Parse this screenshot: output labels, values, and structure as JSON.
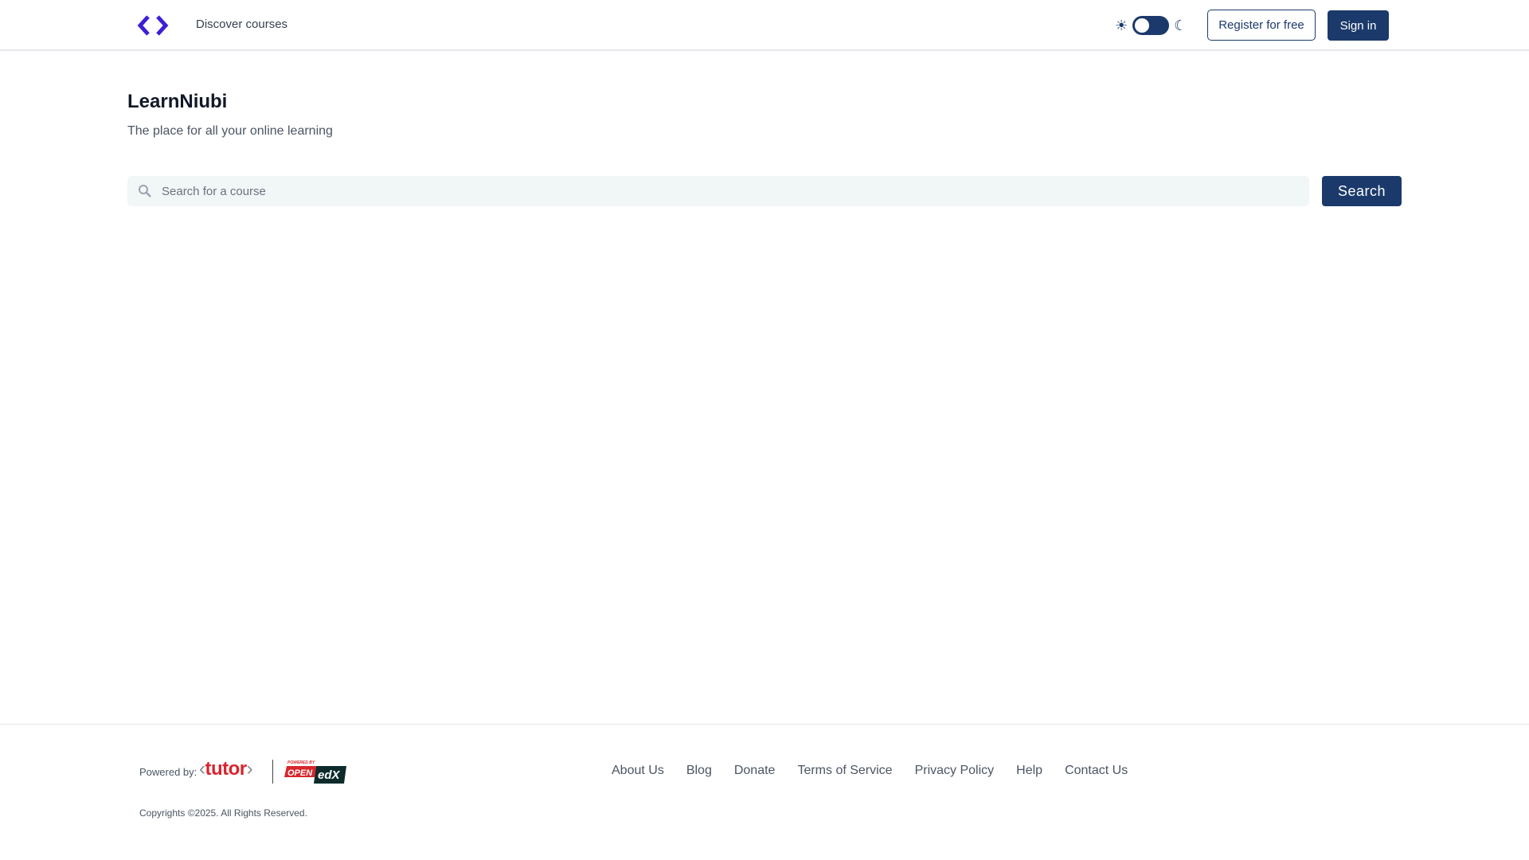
{
  "header": {
    "nav_link": "Discover courses",
    "register_label": "Register for free",
    "signin_label": "Sign in",
    "theme_toggle_on": false
  },
  "hero": {
    "title": "LearnNiubi",
    "subtitle": "The place for all your online learning"
  },
  "search": {
    "placeholder": "Search for a course",
    "value": "",
    "button_label": "Search"
  },
  "footer": {
    "powered_by": "Powered by:",
    "tutor_logo": "tutor",
    "openedx_logo": "POWERED BY OPEN edX",
    "links": [
      "About Us",
      "Blog",
      "Donate",
      "Terms of Service",
      "Privacy Policy",
      "Help",
      "Contact Us"
    ],
    "copyright": "Copyrights ©2025. All Rights Reserved."
  },
  "colors": {
    "brand": "#1b3a6b",
    "logo": "#3b1fd6",
    "tutor": "#d7262d"
  }
}
